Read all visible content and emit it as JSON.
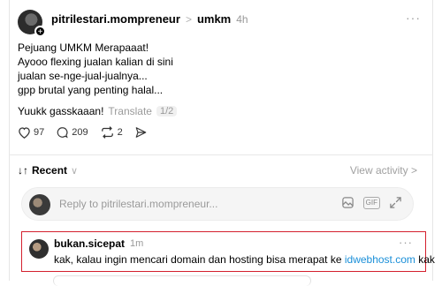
{
  "post": {
    "username": "pitrilestari.mompreneur",
    "separator": ">",
    "community": "umkm",
    "time": "4h",
    "more": "···",
    "lines": [
      "Pejuang UMKM Merapaaat!",
      "Ayooo flexing jualan kalian di sini",
      "jualan se-nge-jual-jualnya...",
      "gpp brutal yang penting halal..."
    ],
    "cta": "Yuukk gasskaaan!",
    "translate": "Translate",
    "page_indicator": "1/2",
    "likes": "97",
    "comments": "209",
    "reposts": "2"
  },
  "sort": {
    "arrow": "↓↑",
    "label": "Recent",
    "caret": "∨",
    "view_activity": "View activity >"
  },
  "reply": {
    "placeholder": "Reply to pitrilestari.mompreneur...",
    "gif_label": "GIF"
  },
  "comment": {
    "username": "bukan.sicepat",
    "time": "1m",
    "more": "···",
    "text_before": "kak, kalau ingin mencari domain dan hosting bisa merapat ke ",
    "link": "idwebhost.com",
    "text_after": " kak"
  },
  "colors": {
    "highlight_border": "#d4202e",
    "link": "#1a8fd8"
  }
}
